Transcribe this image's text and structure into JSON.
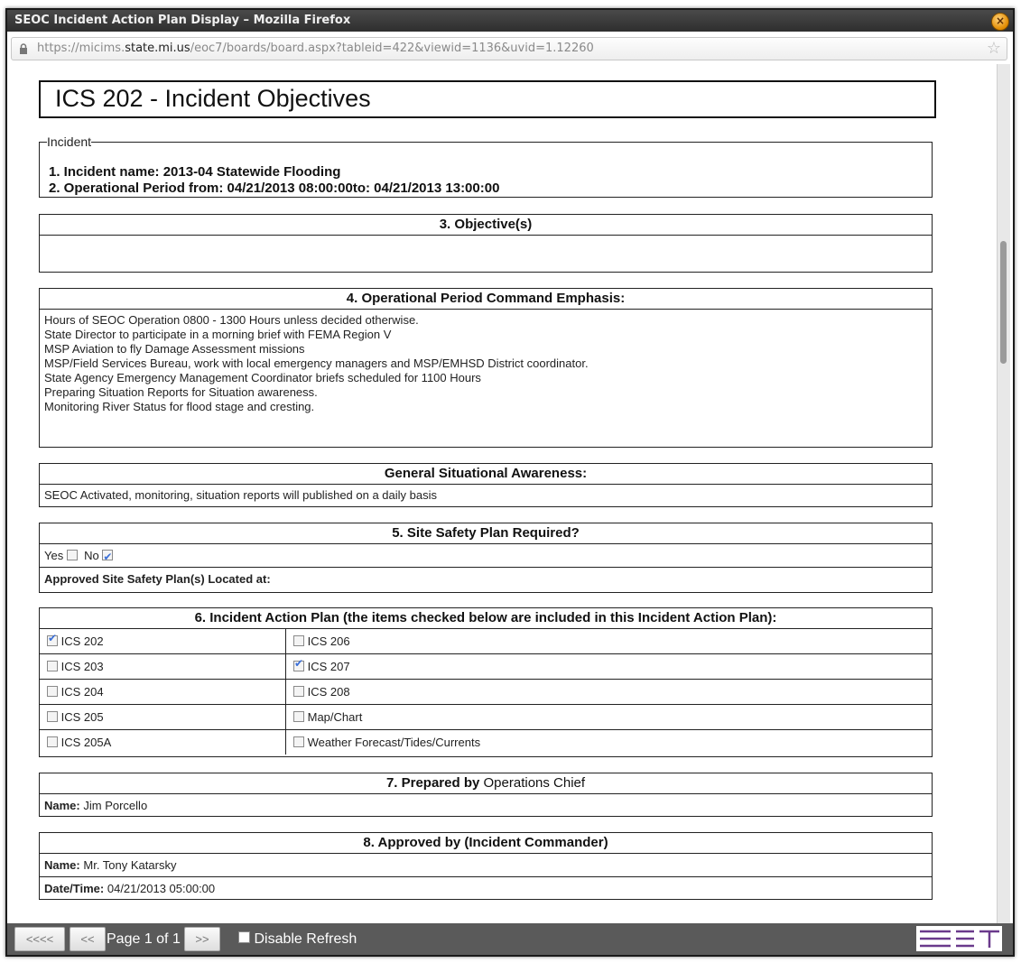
{
  "window": {
    "title": "SEOC Incident Action Plan Display – Mozilla Firefox"
  },
  "urlbar": {
    "prefix": "https://micims.",
    "host": "state.mi.us",
    "path": "/eoc7/boards/board.aspx?tableid=422&viewid=1136&uvid=1.12260"
  },
  "page": {
    "title": "ICS 202 - Incident Objectives"
  },
  "incident": {
    "legend": "Incident",
    "name_line": "1. Incident name: 2013-04 Statewide Flooding",
    "period_line": "2. Operational Period from: 04/21/2013 08:00:00to: 04/21/2013 13:00:00"
  },
  "objectives": {
    "heading": "3. Objective(s)",
    "body": ""
  },
  "command_emphasis": {
    "heading": "4. Operational Period Command Emphasis:",
    "lines": [
      "Hours of SEOC Operation 0800 - 1300 Hours unless decided otherwise.",
      "State Director to participate in a morning brief with FEMA Region V",
      "MSP Aviation to fly Damage Assessment missions",
      "MSP/Field Services Bureau, work with local emergency managers and MSP/EMHSD District coordinator.",
      "State Agency Emergency Management Coordinator briefs scheduled for 1100 Hours",
      "Preparing Situation Reports for Situation awareness.",
      "Monitoring River Status for flood stage and cresting."
    ]
  },
  "situational": {
    "heading": "General Situational Awareness:",
    "body": "SEOC Activated, monitoring, situation reports will published on a daily basis"
  },
  "site_safety": {
    "heading": "5. Site Safety Plan Required?",
    "yes_label": "Yes",
    "no_label": "No",
    "yes_checked": false,
    "no_checked": true,
    "approved_label": "Approved Site Safety Plan(s) Located at:"
  },
  "iap": {
    "heading": "6. Incident Action Plan (the items checked below are included in this Incident Action Plan):",
    "rows": [
      {
        "left": "ICS 202",
        "left_checked": true,
        "right": "ICS 206",
        "right_checked": false
      },
      {
        "left": "ICS 203",
        "left_checked": false,
        "right": "ICS 207",
        "right_checked": true
      },
      {
        "left": "ICS 204",
        "left_checked": false,
        "right": "ICS 208",
        "right_checked": false
      },
      {
        "left": "ICS 205",
        "left_checked": false,
        "right": "Map/Chart",
        "right_checked": false
      },
      {
        "left": "ICS 205A",
        "left_checked": false,
        "right": "Weather Forecast/Tides/Currents",
        "right_checked": false
      }
    ]
  },
  "prepared": {
    "heading_bold": "7. Prepared by",
    "heading_role": "Operations Chief",
    "name_label": "Name:",
    "name_value": "Jim Porcello"
  },
  "approved": {
    "heading": "8. Approved by (Incident Commander)",
    "name_label": "Name:",
    "name_value": "Mr. Tony Katarsky",
    "datetime_label": "Date/Time:",
    "datetime_value": "04/21/2013 05:00:00"
  },
  "footer": {
    "first_btn": "<<<<",
    "prev_btn": "<<",
    "page_label": "Page 1 of 1",
    "next_btn": ">>",
    "refresh_label": "Disable Refresh",
    "refresh_checked": false
  }
}
